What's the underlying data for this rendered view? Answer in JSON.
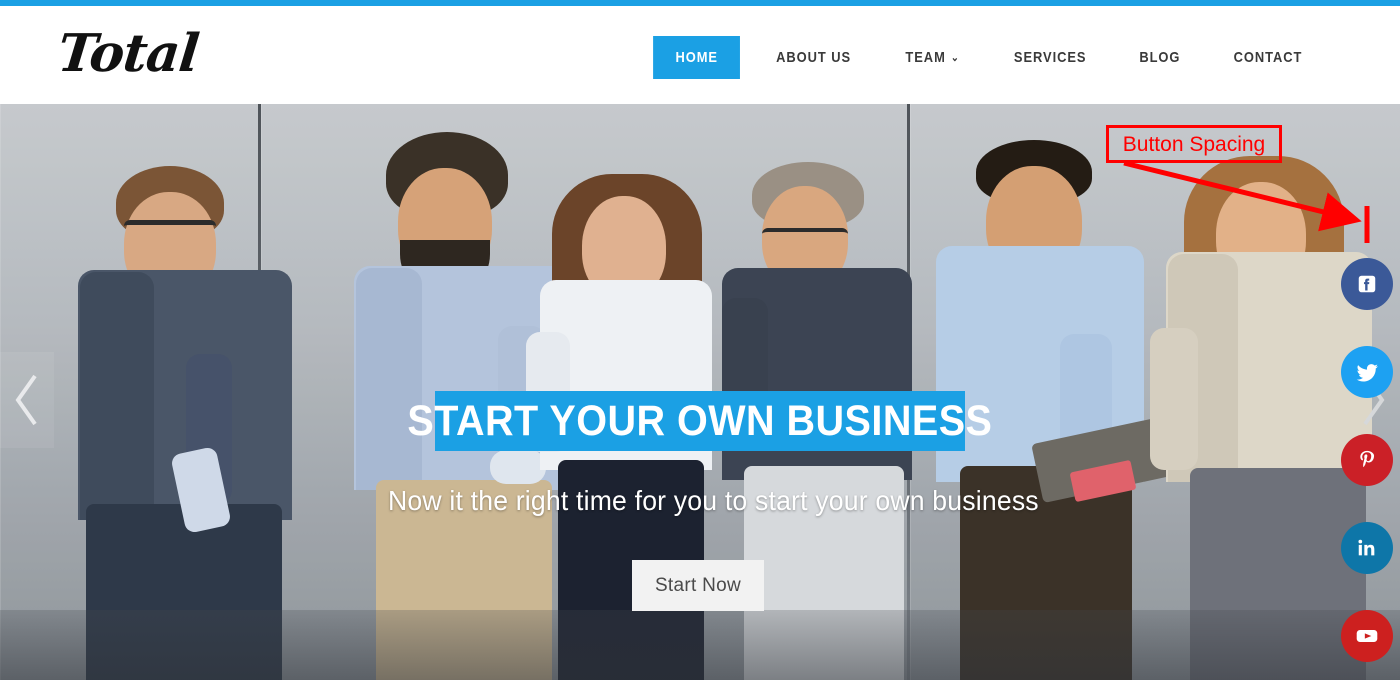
{
  "brand": {
    "logo_text": "Total",
    "accent_color": "#1ba0e4"
  },
  "header": {
    "nav": [
      {
        "label": "HOME",
        "name": "nav-home",
        "active": true,
        "caret": false
      },
      {
        "label": "ABOUT US",
        "name": "nav-about-us",
        "active": false,
        "caret": false
      },
      {
        "label": "TEAM",
        "name": "nav-team",
        "active": false,
        "caret": true
      },
      {
        "label": "SERVICES",
        "name": "nav-services",
        "active": false,
        "caret": false
      },
      {
        "label": "BLOG",
        "name": "nav-blog",
        "active": false,
        "caret": false
      },
      {
        "label": "CONTACT",
        "name": "nav-contact",
        "active": false,
        "caret": false
      }
    ],
    "team_caret_glyph": "⌄"
  },
  "hero": {
    "title": "START YOUR OWN BUSINESS",
    "subtitle": "Now it the right time for you to start your own business",
    "cta_label": "Start Now",
    "title_bar_color": "#1ba0e4",
    "cta_bg_color": "#f2f2f2",
    "prev_arrow_name": "carousel-prev-icon",
    "next_arrow_name": "carousel-next-icon"
  },
  "social": [
    {
      "name": "facebook-button",
      "icon": "facebook-icon",
      "color": "#3b5998",
      "label": "Facebook"
    },
    {
      "name": "twitter-button",
      "icon": "twitter-icon",
      "color": "#1da1f2",
      "label": "Twitter"
    },
    {
      "name": "pinterest-button",
      "icon": "pinterest-icon",
      "color": "#cb2027",
      "label": "Pinterest"
    },
    {
      "name": "linkedin-button",
      "icon": "linkedin-icon",
      "color": "#0e76a8",
      "label": "LinkedIn"
    },
    {
      "name": "youtube-button",
      "icon": "youtube-icon",
      "color": "#cd201f",
      "label": "YouTube"
    }
  ],
  "annotation": {
    "label": "Button Spacing",
    "color": "#ff0000"
  }
}
